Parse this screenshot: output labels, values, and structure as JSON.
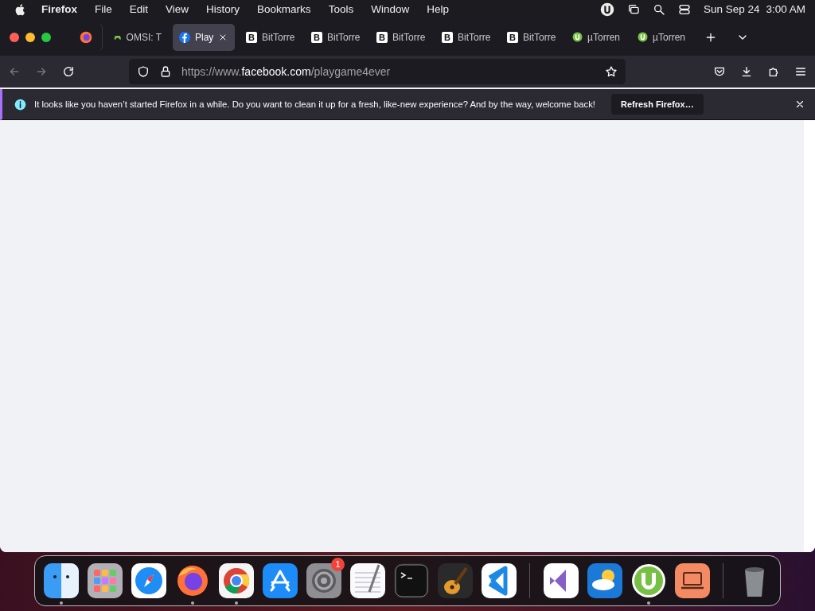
{
  "menu_bar": {
    "app": "Firefox",
    "menus": [
      "File",
      "Edit",
      "View",
      "History",
      "Bookmarks",
      "Tools",
      "Window",
      "Help"
    ],
    "date": "Sun Sep 24",
    "time": "3:00 AM"
  },
  "tabs": [
    {
      "kind": "firefox",
      "selected": false
    },
    {
      "kind": "game",
      "label": "OMSI: T",
      "selected": false
    },
    {
      "kind": "facebook",
      "label": "Play",
      "selected": true
    },
    {
      "kind": "letter",
      "favicon": "B",
      "label": "BitTorre",
      "selected": false
    },
    {
      "kind": "letter",
      "favicon": "B",
      "label": "BitTorre",
      "selected": false
    },
    {
      "kind": "letter",
      "favicon": "B",
      "label": "BitTorre",
      "selected": false
    },
    {
      "kind": "letter",
      "favicon": "B",
      "label": "BitTorre",
      "selected": false
    },
    {
      "kind": "letter",
      "favicon": "B",
      "label": "BitTorre",
      "selected": false
    },
    {
      "kind": "torrent",
      "label": "µTorren",
      "selected": false
    },
    {
      "kind": "torrent",
      "label": "µTorren",
      "selected": false
    }
  ],
  "address_bar": {
    "prefix": "https://www.",
    "domain": "facebook.com",
    "path": "/playgame4ever"
  },
  "notification": {
    "message": "It looks like you haven’t started Firefox in a while. Do you want to clean it up for a fresh, like-new experience? And by the way, welcome back!",
    "button": "Refresh Firefox…"
  },
  "dock": [
    {
      "kind": "finder",
      "running": true
    },
    {
      "kind": "launchpad",
      "running": false
    },
    {
      "kind": "safari",
      "running": false
    },
    {
      "kind": "firefox",
      "running": true
    },
    {
      "kind": "chrome",
      "running": true
    },
    {
      "kind": "appstore",
      "running": false
    },
    {
      "kind": "settings",
      "running": false,
      "badge": "1"
    },
    {
      "kind": "textedit",
      "running": false
    },
    {
      "kind": "terminal",
      "running": false
    },
    {
      "kind": "garageband",
      "running": false
    },
    {
      "kind": "vscode",
      "running": false
    },
    {
      "kind": "separator"
    },
    {
      "kind": "visualstudio",
      "running": false
    },
    {
      "kind": "weather",
      "running": false
    },
    {
      "kind": "torrent",
      "running": true
    },
    {
      "kind": "laptop",
      "running": false
    },
    {
      "kind": "separator"
    },
    {
      "kind": "trash",
      "running": false
    }
  ]
}
